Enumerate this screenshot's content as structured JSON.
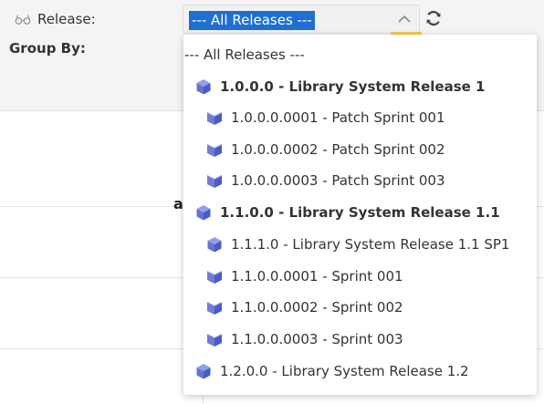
{
  "filters": {
    "release_label": "Release:",
    "group_by_label": "Group By:"
  },
  "select": {
    "selected_value": "--- All Releases ---"
  },
  "dropdown": {
    "options": [
      {
        "label": "--- All Releases ---",
        "level": 0,
        "icon": "none",
        "bold": false
      },
      {
        "label": "1.0.0.0 - Library System Release 1",
        "level": 1,
        "icon": "release-cube-icon",
        "bold": true
      },
      {
        "label": "1.0.0.0.0001 - Patch Sprint 001",
        "level": 2,
        "icon": "sprint-book-icon",
        "bold": false
      },
      {
        "label": "1.0.0.0.0002 - Patch Sprint 002",
        "level": 2,
        "icon": "sprint-book-icon",
        "bold": false
      },
      {
        "label": "1.0.0.0.0003 - Patch Sprint 003",
        "level": 2,
        "icon": "sprint-book-icon",
        "bold": false
      },
      {
        "label": "1.1.0.0 - Library System Release 1.1",
        "level": 1,
        "icon": "release-cube-icon",
        "bold": true
      },
      {
        "label": "1.1.1.0 - Library System Release 1.1 SP1",
        "level": 2,
        "icon": "release-cube-icon",
        "bold": false
      },
      {
        "label": "1.1.0.0.0001 - Sprint 001",
        "level": 2,
        "icon": "sprint-book-icon",
        "bold": false
      },
      {
        "label": "1.1.0.0.0002 - Sprint 002",
        "level": 2,
        "icon": "sprint-book-icon",
        "bold": false
      },
      {
        "label": "1.1.0.0.0003 - Sprint 003",
        "level": 2,
        "icon": "sprint-book-icon",
        "bold": false
      },
      {
        "label": "1.2.0.0 - Library System Release 1.2",
        "level": 1,
        "icon": "release-cube-icon",
        "bold": false
      }
    ]
  },
  "colors": {
    "selection": "#1e6fd1",
    "cube_light": "#8fa0e8",
    "cube_dark": "#4b5bc4",
    "accent": "#f2c94c"
  }
}
